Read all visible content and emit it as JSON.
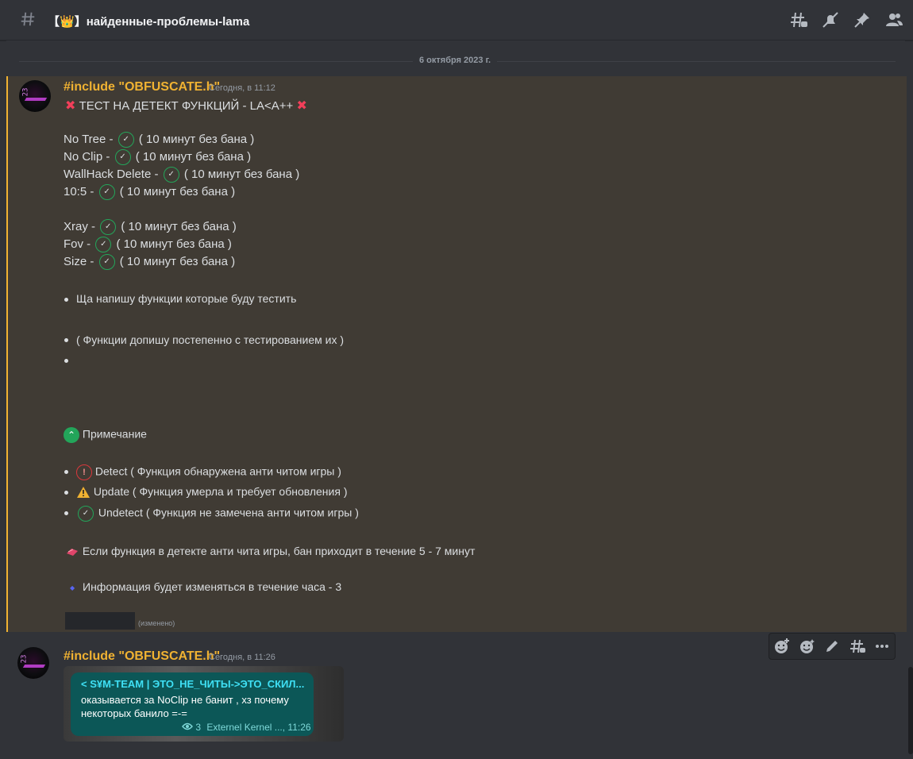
{
  "channel": {
    "title_prefix": "【",
    "crown": "👑",
    "title_suffix": "】найденные-проблемы-lama"
  },
  "date_divider": "6 октября 2023 г.",
  "message1": {
    "author": "#include \"OBFUSCATE.h\"",
    "timestamp": "Сегодня, в 11:12",
    "heading": "ТЕСТ НА ДЕТЕКТ ФУНКЦИЙ - LA<A++",
    "features_a": [
      {
        "name": "No Tree - ",
        "note": "( 10 минут без бана )"
      },
      {
        "name": "No Clip - ",
        "note": "( 10 минут без бана )"
      },
      {
        "name": "WallHack Delete - ",
        "note": "( 10 минут без бана )"
      },
      {
        "name": "10:5 - ",
        "note": "( 10 минут без бана )"
      }
    ],
    "features_b": [
      {
        "name": "Xray - ",
        "note": "( 10 минут без бана )"
      },
      {
        "name": "Fov - ",
        "note": "( 10 минут без бана )"
      },
      {
        "name": "Size - ",
        "note": "( 10 минут без бана )"
      }
    ],
    "bullet1": "Ща напишу функции которые буду тестить",
    "bullet2": "( Функции допишу постепенно с тестированием их )",
    "note_title": "Примечание",
    "legend": [
      {
        "label": "Detect ( Функция обнаружена анти читом игры )"
      },
      {
        "label": "Update ( Функция умерла и требует обновления )"
      },
      {
        "label": "Undetect ( Функция не замечена анти читом игры )"
      }
    ],
    "ban_info": "Если функция в детекте анти чита игры, бан приходит в течение 5 - 7 минут",
    "info_update": "Информация будет изменяться в течение часа - 3",
    "edited": "(изменено)"
  },
  "message2": {
    "author": "#include \"OBFUSCATE.h\"",
    "timestamp": "Сегодня, в 11:26",
    "embed": {
      "title": "< S¥M-TEAM | ЭТО_НЕ_ЧИТЫ->ЭТО_СКИЛ...",
      "line1": "оказывается за NoClip не банит , хз почему",
      "line2": "некоторых банило =-=",
      "views": "3",
      "meta": "Externel Kernel ..., 11:26"
    }
  },
  "colors": {
    "accent": "#f0b232",
    "success": "#23a55a",
    "danger": "#da373c",
    "embed_bg": "#0c5757"
  },
  "icons": [
    "hash-icon",
    "threads-icon",
    "mute-icon",
    "pin-icon",
    "members-icon",
    "add-reaction-icon",
    "super-reaction-icon",
    "edit-icon",
    "thread-icon",
    "more-icon"
  ]
}
